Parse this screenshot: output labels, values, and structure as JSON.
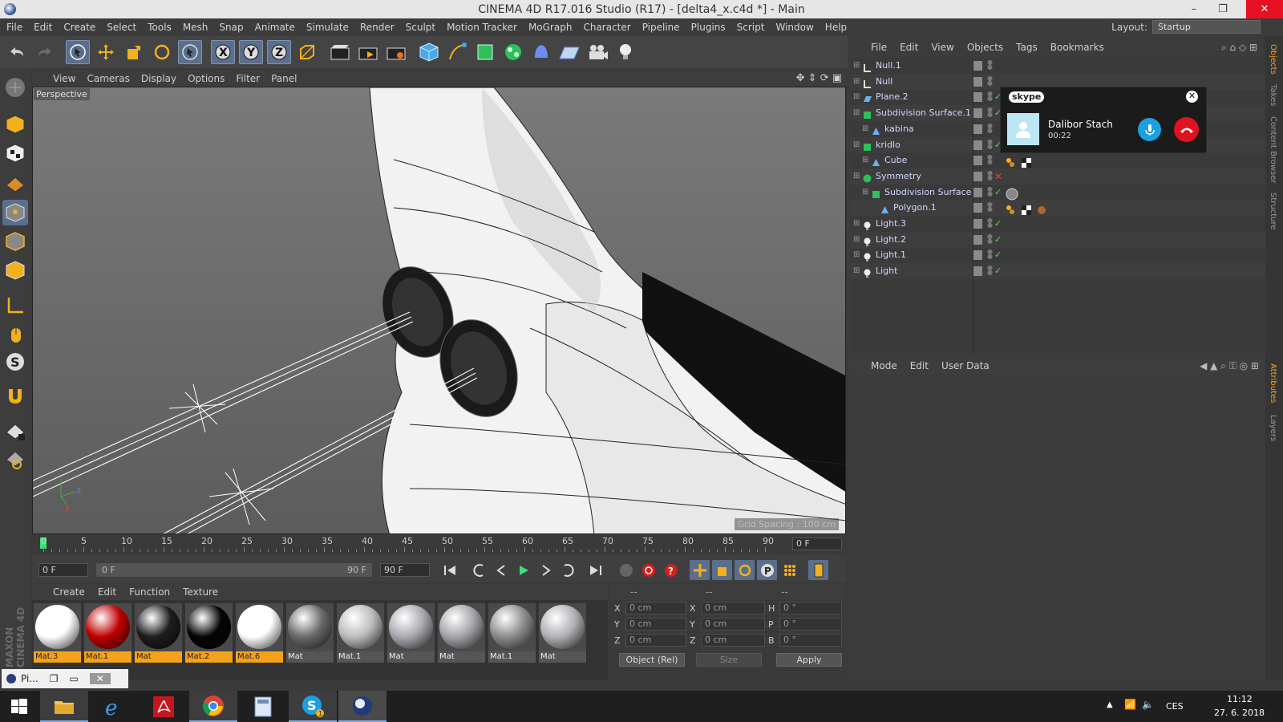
{
  "window": {
    "title": "CINEMA 4D R17.016 Studio (R17) - [delta4_x.c4d *] - Main",
    "min": "–",
    "max": "❐",
    "close": "✕"
  },
  "menubar": {
    "items": [
      "File",
      "Edit",
      "Create",
      "Select",
      "Tools",
      "Mesh",
      "Snap",
      "Animate",
      "Simulate",
      "Render",
      "Sculpt",
      "Motion Tracker",
      "MoGraph",
      "Character",
      "Pipeline",
      "Plugins",
      "Script",
      "Window",
      "Help"
    ],
    "layout_label": "Layout:",
    "layout_value": "Startup"
  },
  "viewport": {
    "menu": [
      "View",
      "Cameras",
      "Display",
      "Options",
      "Filter",
      "Panel"
    ],
    "label": "Perspective",
    "grid_spacing": "Grid Spacing : 100 cm"
  },
  "timeline": {
    "ticks": [
      "0",
      "5",
      "10",
      "15",
      "20",
      "25",
      "30",
      "35",
      "40",
      "45",
      "50",
      "55",
      "60",
      "65",
      "70",
      "75",
      "80",
      "85",
      "90"
    ],
    "current_frame": "0 F",
    "start_field": "0 F",
    "range_start": "0 F",
    "range_end": "90 F",
    "end_field": "90 F"
  },
  "materials": {
    "menu": [
      "Create",
      "Edit",
      "Function",
      "Texture"
    ],
    "items": [
      {
        "name": "Mat.3",
        "color": "#ffffff"
      },
      {
        "name": "Mat.1",
        "color": "#c00000"
      },
      {
        "name": "Mat",
        "color": "#1e1e1e"
      },
      {
        "name": "Mat.2",
        "color": "#050505"
      },
      {
        "name": "Mat.6",
        "color": "#ffffff"
      },
      {
        "name": "Mat",
        "color": "#6a6a6a"
      },
      {
        "name": "Mat.1",
        "color": "#bcbcbc"
      },
      {
        "name": "Mat",
        "color": "#a9a9b0"
      },
      {
        "name": "Mat",
        "color": "#a4a4aa"
      },
      {
        "name": "Mat.1",
        "color": "#8d8d8d"
      },
      {
        "name": "Mat",
        "color": "#b1b1b6"
      }
    ]
  },
  "coordinates": {
    "header": [
      "--",
      "--",
      "--"
    ],
    "rows": [
      {
        "l1": "X",
        "v1": "0 cm",
        "l2": "X",
        "v2": "0 cm",
        "l3": "H",
        "v3": "0 °"
      },
      {
        "l1": "Y",
        "v1": "0 cm",
        "l2": "Y",
        "v2": "0 cm",
        "l3": "P",
        "v3": "0 °"
      },
      {
        "l1": "Z",
        "v1": "0 cm",
        "l2": "Z",
        "v2": "0 cm",
        "l3": "B",
        "v3": "0 °"
      }
    ],
    "mode": "Object (Rel)",
    "size": "Size",
    "apply": "Apply"
  },
  "objects": {
    "menu": [
      "File",
      "Edit",
      "View",
      "Objects",
      "Tags",
      "Bookmarks"
    ],
    "rows": [
      {
        "name": "Null.1",
        "indent": 0,
        "icon": "null-icon",
        "check": ""
      },
      {
        "name": "Null",
        "indent": 0,
        "icon": "null-icon",
        "check": ""
      },
      {
        "name": "Plane.2",
        "indent": 0,
        "icon": "plane-icon",
        "check": "✓"
      },
      {
        "name": "Subdivision Surface.1",
        "indent": 0,
        "icon": "subdivision-icon",
        "check": "✓"
      },
      {
        "name": "kabina",
        "indent": 1,
        "icon": "polygon-icon",
        "check": ""
      },
      {
        "name": "kridlo",
        "indent": 0,
        "icon": "subdivision-icon",
        "check": "✓"
      },
      {
        "name": "Cube",
        "indent": 1,
        "icon": "polygon-icon",
        "check": ""
      },
      {
        "name": "Symmetry",
        "indent": 0,
        "icon": "symmetry-icon",
        "check": "✕"
      },
      {
        "name": "Subdivision Surface",
        "indent": 1,
        "icon": "subdivision-icon",
        "check": "✓"
      },
      {
        "name": "Polygon.1",
        "indent": 2,
        "icon": "polygon-icon",
        "check": ""
      },
      {
        "name": "Light.3",
        "indent": 0,
        "icon": "light-icon",
        "check": "✓"
      },
      {
        "name": "Light.2",
        "indent": 0,
        "icon": "light-icon",
        "check": "✓"
      },
      {
        "name": "Light.1",
        "indent": 0,
        "icon": "light-icon",
        "check": "✓"
      },
      {
        "name": "Light",
        "indent": 0,
        "icon": "light-icon",
        "check": "✓"
      }
    ]
  },
  "attributes": {
    "menu": [
      "Mode",
      "Edit",
      "User Data"
    ]
  },
  "side_tabs": [
    "Objects",
    "Takes",
    "Content Browser",
    "Structure",
    "Attributes",
    "Layers"
  ],
  "skype": {
    "logo": "skype",
    "caller": "Dalibor Stach",
    "duration": "00:22",
    "close": "✕"
  },
  "brand": "MAXON CINEMA 4D",
  "mini_window": {
    "title": "Pi...",
    "restore": "❐",
    "minimize": "▭",
    "close": "✕"
  },
  "taskbar": {
    "lang": "CES",
    "time": "11:12",
    "date": "27. 6. 2018"
  }
}
